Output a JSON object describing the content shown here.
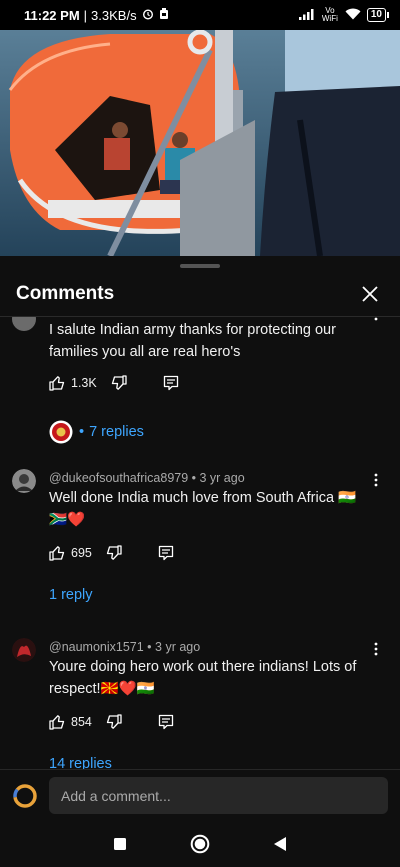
{
  "status_bar": {
    "time": "11:22 PM",
    "speed": "3.3KB/s",
    "network": "Vo WiFi",
    "battery": "10"
  },
  "video": {
    "description_icon": "video-player"
  },
  "panel": {
    "title": "Comments",
    "close_icon": "close-icon"
  },
  "comments": [
    {
      "author_meta": "",
      "text": "I salute Indian army thanks for protecting our families you all are real hero's",
      "likes": "1.3K",
      "replies_label": "7 replies",
      "reply_dot": "•"
    },
    {
      "author_meta": "@dukeofsouthafrica8979 • 3 yr ago",
      "text": "Well done India much love from South Africa 🇮🇳 🇿🇦❤️",
      "likes": "695",
      "replies_label": "1 reply"
    },
    {
      "author_meta": "@naumonix1571 • 3 yr ago",
      "text": "Youre doing hero work out there indians! Lots of respect!🇲🇰❤️🇮🇳",
      "likes": "854",
      "replies_label": "14 replies"
    }
  ],
  "add_comment": {
    "placeholder": "Add a comment..."
  },
  "colors": {
    "background": "#0f0f0f",
    "link": "#3ea6ff",
    "input_bg": "#272727"
  }
}
